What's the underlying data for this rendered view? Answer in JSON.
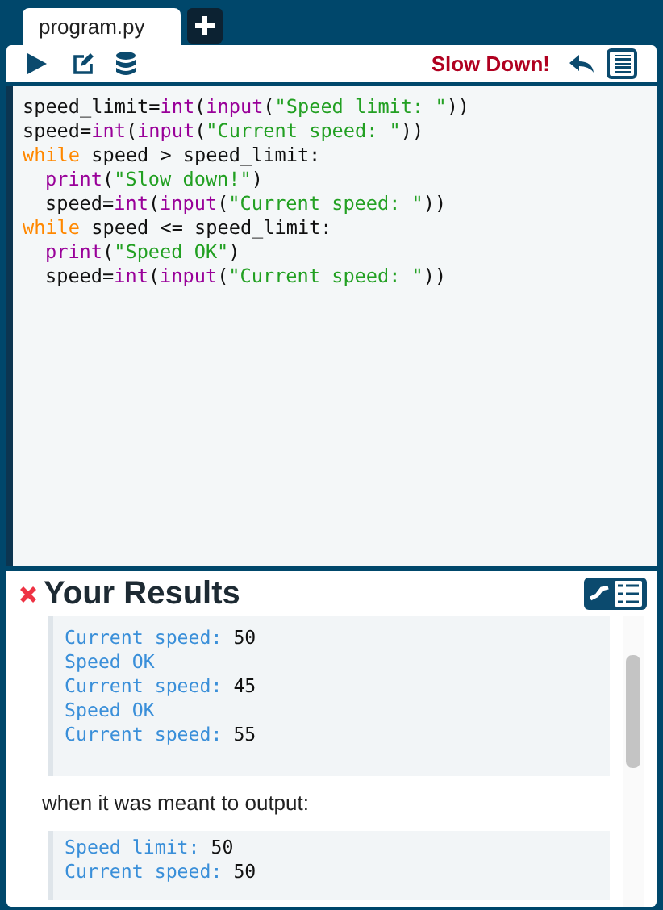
{
  "tabs": [
    {
      "label": "program.py",
      "selected": true
    }
  ],
  "toolbar": {
    "status": "Slow Down!"
  },
  "code": [
    {
      "indented": false,
      "tokens": [
        {
          "kind": "plain",
          "text": "speed_limit="
        },
        {
          "kind": "builtin",
          "text": "int"
        },
        {
          "kind": "plain",
          "text": "("
        },
        {
          "kind": "builtin",
          "text": "input"
        },
        {
          "kind": "plain",
          "text": "("
        },
        {
          "kind": "string",
          "text": "\"Speed limit: \""
        },
        {
          "kind": "plain",
          "text": "))"
        }
      ]
    },
    {
      "indented": false,
      "tokens": [
        {
          "kind": "plain",
          "text": "speed="
        },
        {
          "kind": "builtin",
          "text": "int"
        },
        {
          "kind": "plain",
          "text": "("
        },
        {
          "kind": "builtin",
          "text": "input"
        },
        {
          "kind": "plain",
          "text": "("
        },
        {
          "kind": "string",
          "text": "\"Current speed: \""
        },
        {
          "kind": "plain",
          "text": "))"
        }
      ]
    },
    {
      "indented": false,
      "tokens": [
        {
          "kind": "keyword",
          "text": "while"
        },
        {
          "kind": "plain",
          "text": " speed > speed_limit:"
        }
      ]
    },
    {
      "indented": true,
      "tokens": [
        {
          "kind": "builtin",
          "text": "print"
        },
        {
          "kind": "plain",
          "text": "("
        },
        {
          "kind": "string",
          "text": "\"Slow down!\""
        },
        {
          "kind": "plain",
          "text": ")"
        }
      ]
    },
    {
      "indented": true,
      "tokens": [
        {
          "kind": "plain",
          "text": "speed="
        },
        {
          "kind": "builtin",
          "text": "int"
        },
        {
          "kind": "plain",
          "text": "("
        },
        {
          "kind": "builtin",
          "text": "input"
        },
        {
          "kind": "plain",
          "text": "("
        },
        {
          "kind": "string",
          "text": "\"Current speed: \""
        },
        {
          "kind": "plain",
          "text": "))"
        }
      ]
    },
    {
      "indented": false,
      "tokens": [
        {
          "kind": "keyword",
          "text": "while"
        },
        {
          "kind": "plain",
          "text": " speed <= speed_limit:"
        }
      ]
    },
    {
      "indented": true,
      "tokens": [
        {
          "kind": "builtin",
          "text": "print"
        },
        {
          "kind": "plain",
          "text": "("
        },
        {
          "kind": "string",
          "text": "\"Speed OK\""
        },
        {
          "kind": "plain",
          "text": ")"
        }
      ]
    },
    {
      "indented": true,
      "tokens": [
        {
          "kind": "plain",
          "text": "speed="
        },
        {
          "kind": "builtin",
          "text": "int"
        },
        {
          "kind": "plain",
          "text": "("
        },
        {
          "kind": "builtin",
          "text": "input"
        },
        {
          "kind": "plain",
          "text": "("
        },
        {
          "kind": "string",
          "text": "\"Current speed: \""
        },
        {
          "kind": "plain",
          "text": "))"
        }
      ]
    }
  ],
  "results": {
    "title": "Your Results",
    "passed": false,
    "actual": [
      {
        "prompt": "Current speed: ",
        "input": "50"
      },
      {
        "prompt": "Speed OK"
      },
      {
        "prompt": "Current speed: ",
        "input": "45"
      },
      {
        "prompt": "Speed OK"
      },
      {
        "prompt": "Current speed: ",
        "input": "55"
      }
    ],
    "message": "when it was meant to output:",
    "expected": [
      {
        "prompt": "Speed limit: ",
        "input": "50"
      },
      {
        "prompt": "Current speed: ",
        "input": "50"
      }
    ]
  }
}
